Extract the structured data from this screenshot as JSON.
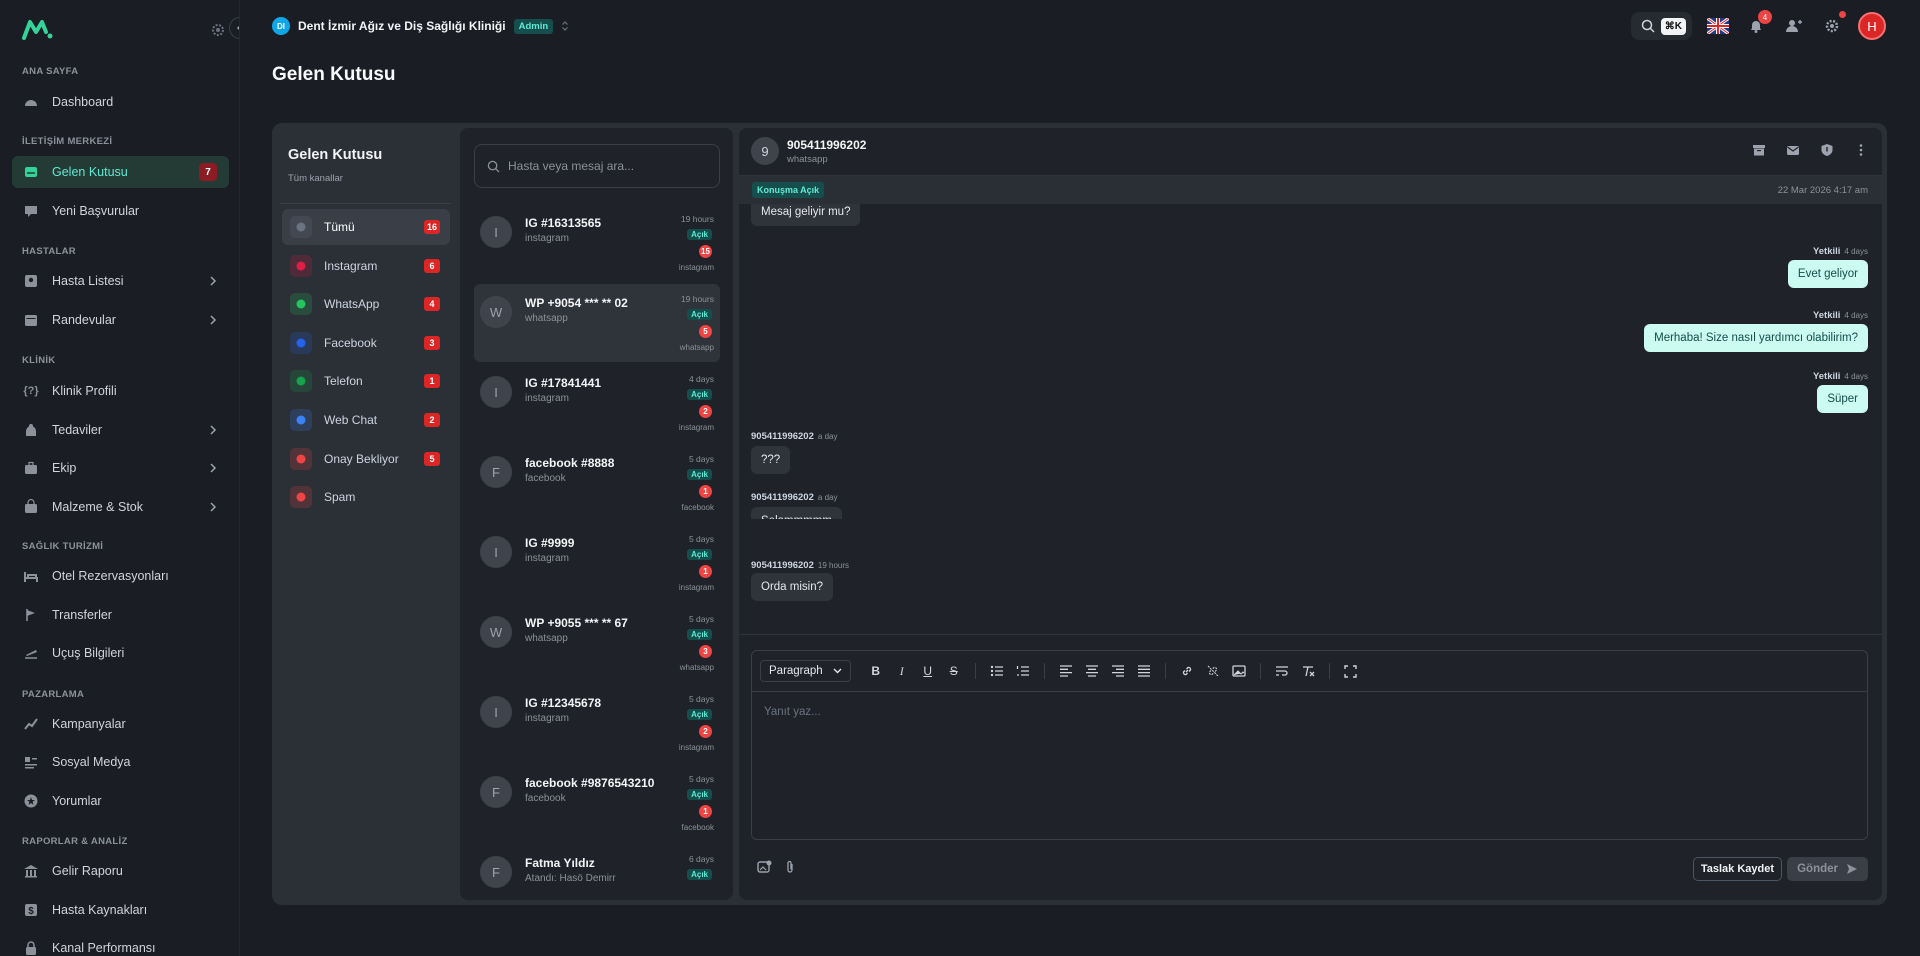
{
  "sidebar": {
    "sections": {
      "home": "ANA SAYFA",
      "comm": "İLETİŞİM MERKEZİ",
      "patients": "HASTALAR",
      "clinic": "KLİNİK",
      "tourism": "SAĞLIK TURİZMİ",
      "marketing": "PAZARLAMA",
      "reports": "RAPORLAR & ANALİZ"
    },
    "items": {
      "dashboard": "Dashboard",
      "inbox": "Gelen Kutusu",
      "inbox_count": "7",
      "applications": "Yeni Başvurular",
      "patient_list": "Hasta Listesi",
      "appointments": "Randevular",
      "clinic_profile": "Klinik Profili",
      "treatments": "Tedaviler",
      "team": "Ekip",
      "stock": "Malzeme & Stok",
      "hotels": "Otel Rezervasyonları",
      "transfers": "Transferler",
      "flights": "Uçuş Bilgileri",
      "campaigns": "Kampanyalar",
      "social": "Sosyal Medya",
      "reviews": "Yorumlar",
      "income": "Gelir Raporu",
      "patient_sources": "Hasta Kaynakları",
      "channel_perf": "Kanal Performansı"
    }
  },
  "topbar": {
    "clinic_initials": "DI",
    "clinic_name": "Dent İzmir Ağız ve Diş Sağlığı Kliniği",
    "role_badge": "Admin",
    "search_kbd": "⌘K",
    "notification_count": "4",
    "user_initial": "H"
  },
  "page": {
    "title": "Gelen Kutusu"
  },
  "channels": {
    "title": "Gelen Kutusu",
    "subtitle": "Tüm kanallar",
    "items": [
      {
        "label": "Tümü",
        "count": "16",
        "color": "#6b7280"
      },
      {
        "label": "Instagram",
        "count": "6",
        "color": "#e11d48"
      },
      {
        "label": "WhatsApp",
        "count": "4",
        "color": "#22c55e"
      },
      {
        "label": "Facebook",
        "count": "3",
        "color": "#2563eb"
      },
      {
        "label": "Telefon",
        "count": "1",
        "color": "#16a34a"
      },
      {
        "label": "Web Chat",
        "count": "2",
        "color": "#3b82f6"
      },
      {
        "label": "Onay Bekliyor",
        "count": "5",
        "color": "#ef4444"
      },
      {
        "label": "Spam",
        "count": "",
        "color": "#ef4444"
      }
    ]
  },
  "conversations": {
    "search_placeholder": "Hasta veya mesaj ara...",
    "items": [
      {
        "initial": "I",
        "name": "IG #16313565",
        "source": "instagram",
        "time": "19 hours",
        "status": "Açık",
        "unread": "15",
        "channel": "instagram"
      },
      {
        "initial": "W",
        "name": "WP +9054 *** ** 02",
        "source": "whatsapp",
        "time": "19 hours",
        "status": "Açık",
        "unread": "5",
        "channel": "whatsapp"
      },
      {
        "initial": "I",
        "name": "IG #17841441",
        "source": "instagram",
        "time": "4 days",
        "status": "Açık",
        "unread": "2",
        "channel": "instagram"
      },
      {
        "initial": "F",
        "name": "facebook #8888",
        "source": "facebook",
        "time": "5 days",
        "status": "Açık",
        "unread": "1",
        "channel": "facebook"
      },
      {
        "initial": "I",
        "name": "IG #9999",
        "source": "instagram",
        "time": "5 days",
        "status": "Açık",
        "unread": "1",
        "channel": "instagram"
      },
      {
        "initial": "W",
        "name": "WP +9055 *** ** 67",
        "source": "whatsapp",
        "time": "5 days",
        "status": "Açık",
        "unread": "3",
        "channel": "whatsapp"
      },
      {
        "initial": "I",
        "name": "IG #12345678",
        "source": "instagram",
        "time": "5 days",
        "status": "Açık",
        "unread": "2",
        "channel": "instagram"
      },
      {
        "initial": "F",
        "name": "facebook #9876543210",
        "source": "facebook",
        "time": "5 days",
        "status": "Açık",
        "unread": "1",
        "channel": "facebook"
      },
      {
        "initial": "F",
        "name": "Fatma Yıldız",
        "source": "Atandı: Hasö Demirr",
        "time": "6 days",
        "status": "Açık",
        "unread": "",
        "channel": "phone"
      }
    ]
  },
  "chat": {
    "initial": "9",
    "name": "905411996202",
    "source": "whatsapp",
    "status": "Konuşma Açık",
    "date": "22 Mar 2026 4:17 am",
    "messages": [
      {
        "dir": "in",
        "text": "Mesaj geliyir mu?"
      },
      {
        "dir": "out",
        "author": "Yetkili",
        "time": "4 days",
        "text": "Evet geliyor"
      },
      {
        "dir": "out",
        "author": "Yetkili",
        "time": "4 days",
        "text": "Merhaba! Size nasıl yardımcı olabilirim?"
      },
      {
        "dir": "out",
        "author": "Yetkili",
        "time": "4 days",
        "text": "Süper"
      },
      {
        "dir": "in",
        "author": "905411996202",
        "time": "a day",
        "text": "???"
      },
      {
        "dir": "in",
        "author": "905411996202",
        "time": "a day",
        "text": "Selammmmm"
      },
      {
        "dir": "in",
        "author": "905411996202",
        "time": "19 hours",
        "text": "Orda misin?"
      }
    ],
    "editor": {
      "block_type": "Paragraph",
      "placeholder": "Yanıt yaz...",
      "draft_label": "Taslak Kaydet",
      "send_label": "Gönder"
    }
  }
}
